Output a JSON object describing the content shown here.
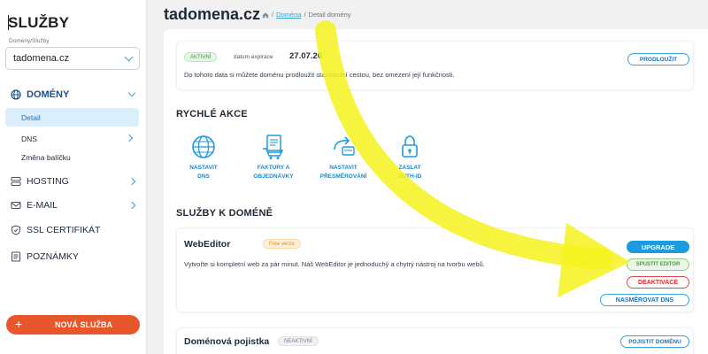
{
  "sidebar": {
    "brand": "SLUŽBY",
    "brand_sub": "Domény/Služby",
    "selected_domain": "tadomena.cz",
    "domeny_label": "DOMÉNY",
    "sub_items": [
      "Detail",
      "DNS",
      "Změna balíčku"
    ],
    "nav": {
      "hosting": "HOSTING",
      "email": "E-MAIL",
      "ssl": "SSL CERTIFIKÁT",
      "notes": "POZNÁMKY"
    },
    "new_service": "NOVÁ SLUŽBA"
  },
  "header": {
    "title": "tadomena.cz",
    "breadcrumb_link": "Doména",
    "breadcrumb_sep": "/",
    "breadcrumb_current": "Detail domény"
  },
  "status_card": {
    "badge": "AKTIVNÍ",
    "expiry_label": "datum expirace",
    "expiry_date": "27.07.20",
    "description": "Do tohoto data si můžete doménu prodloužit standardní cestou, bez omezení její funkčnosti.",
    "renew_button": "PRODLOUŽIT"
  },
  "quick_actions": {
    "title": "RYCHLÉ AKCE",
    "items": [
      {
        "label": "NASTAVIT\nDNS",
        "icon": "globe-icon"
      },
      {
        "label": "FAKTURY A\nOBJEDNÁVKY",
        "icon": "invoice-cart-icon"
      },
      {
        "label": "NASTAVIT\nPŘESMĚROVÁNÍ",
        "icon": "redirect-icon"
      },
      {
        "label": "ZASLAT\nAUTH-ID",
        "icon": "lock-icon"
      }
    ]
  },
  "services": {
    "title": "SLUŽBY K DOMÉNĚ",
    "webeditor": {
      "name": "WebEditor",
      "badge": "Free verze",
      "description": "Vytvořte si kompletní web za pár minut. Náš WebEditor je jednoduchý a chytrý nástroj na tvorbu webů.",
      "upgrade": "UPGRADE",
      "launch": "SPUSTIT EDITOR",
      "deactivate": "DEAKTIVACE",
      "redirect_dns": "NASMĚROVAT DNS"
    },
    "insurance": {
      "name": "Doménová pojistka",
      "badge": "NEAKTIVNÍ",
      "button": "POJISTIT DOMÉNU"
    }
  },
  "colors": {
    "accent_blue": "#1e9be0",
    "orange": "#e8572b",
    "highlight_arrow": "#f5f21c"
  }
}
